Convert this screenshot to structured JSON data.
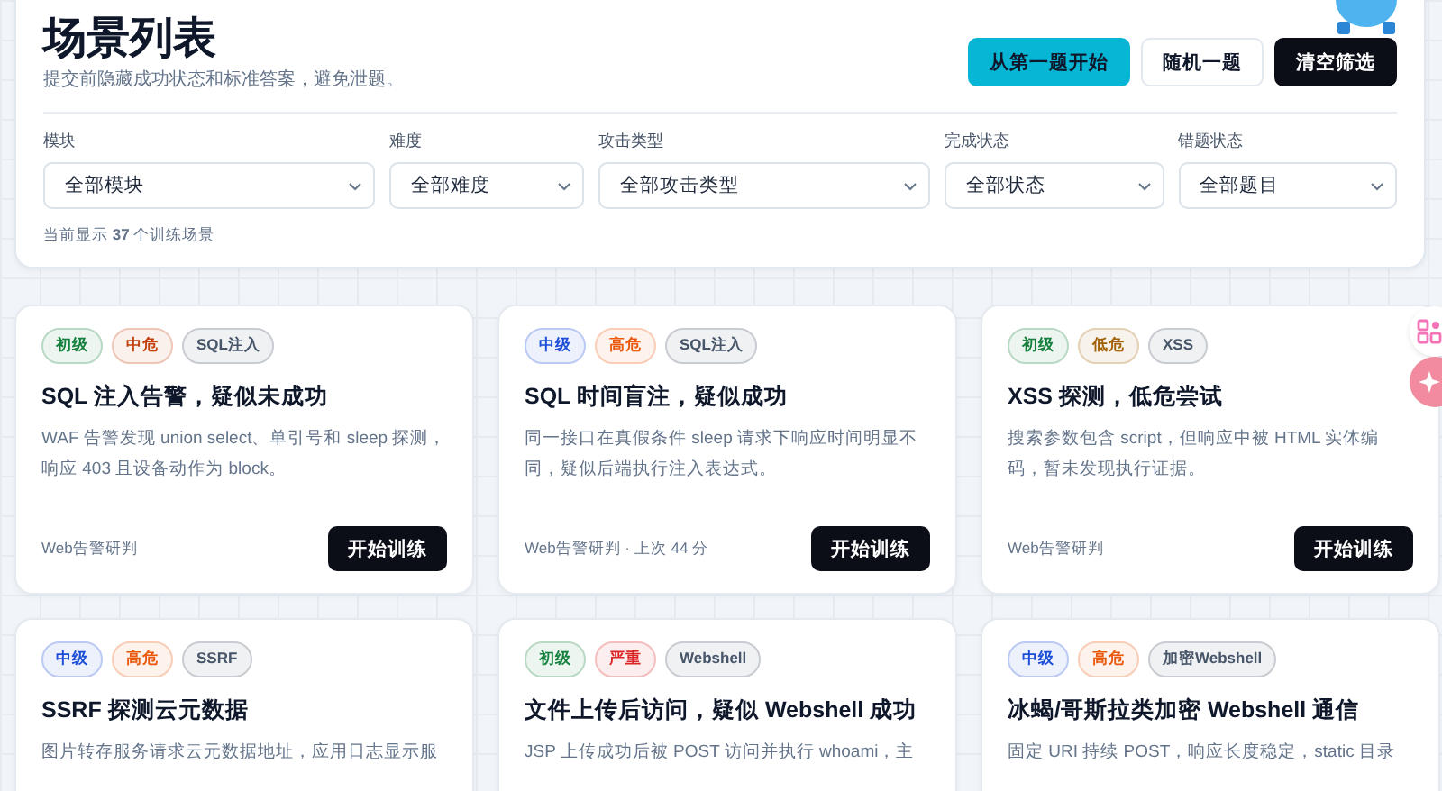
{
  "header": {
    "title": "场景列表",
    "subtitle": "提交前隐藏成功状态和标准答案，避免泄题。",
    "buttons": [
      {
        "label": "从第一题开始",
        "kind": "accent"
      },
      {
        "label": "随机一题",
        "kind": "plain"
      },
      {
        "label": "清空筛选",
        "kind": "dark"
      }
    ]
  },
  "filters": [
    {
      "label": "模块",
      "value": "全部模块"
    },
    {
      "label": "难度",
      "value": "全部难度"
    },
    {
      "label": "攻击类型",
      "value": "全部攻击类型"
    },
    {
      "label": "完成状态",
      "value": "全部状态"
    },
    {
      "label": "错题状态",
      "value": "全部题目"
    }
  ],
  "count": "当前显示 **37** 个训练场景",
  "cards": [
    {
      "tags": [
        {
          "label": "初级",
          "color": "#15803d"
        },
        {
          "label": "中危",
          "color": "#c2410c"
        },
        {
          "label": "SQL注入",
          "color": "#475569"
        }
      ],
      "title": "SQL 注入告警，疑似未成功",
      "description": "WAF 告警发现 union select、单引号和 sleep 探测，响应 403 且设备动作为 block。",
      "footer": "Web告警研判",
      "button": "开始训练"
    },
    {
      "tags": [
        {
          "label": "中级",
          "color": "#1d4ed8"
        },
        {
          "label": "高危",
          "color": "#ea580c"
        },
        {
          "label": "SQL注入",
          "color": "#475569"
        }
      ],
      "title": "SQL 时间盲注，疑似成功",
      "description": "同一接口在真假条件 sleep 请求下响应时间明显不同，疑似后端执行注入表达式。",
      "footer": "Web告警研判 · 上次 44 分",
      "button": "开始训练"
    },
    {
      "tags": [
        {
          "label": "初级",
          "color": "#15803d"
        },
        {
          "label": "低危",
          "color": "#a16207"
        },
        {
          "label": "XSS",
          "color": "#475569"
        }
      ],
      "title": "XSS 探测，低危尝试",
      "description": "搜索参数包含 script，但响应中被 HTML 实体编码，暂未发现执行证据。",
      "footer": "Web告警研判",
      "button": "开始训练"
    },
    {
      "tags": [
        {
          "label": "中级",
          "color": "#1d4ed8"
        },
        {
          "label": "高危",
          "color": "#ea580c"
        },
        {
          "label": "SSRF",
          "color": "#475569"
        }
      ],
      "title": "SSRF 探测云元数据",
      "description": "图片转存服务请求云元数据地址，应用日志显示服"
    },
    {
      "tags": [
        {
          "label": "初级",
          "color": "#15803d"
        },
        {
          "label": "严重",
          "color": "#dc2626"
        },
        {
          "label": "Webshell",
          "color": "#475569"
        }
      ],
      "title": "文件上传后访问，疑似 Webshell 成功",
      "description": "JSP 上传成功后被 POST 访问并执行 whoami，主"
    },
    {
      "tags": [
        {
          "label": "中级",
          "color": "#1d4ed8"
        },
        {
          "label": "高危",
          "color": "#ea580c"
        },
        {
          "label": "加密Webshell",
          "color": "#475569"
        }
      ],
      "title": "冰蝎/哥斯拉类加密 Webshell 通信",
      "description": "固定 URI 持续 POST，响应长度稳定，static 目录"
    }
  ]
}
